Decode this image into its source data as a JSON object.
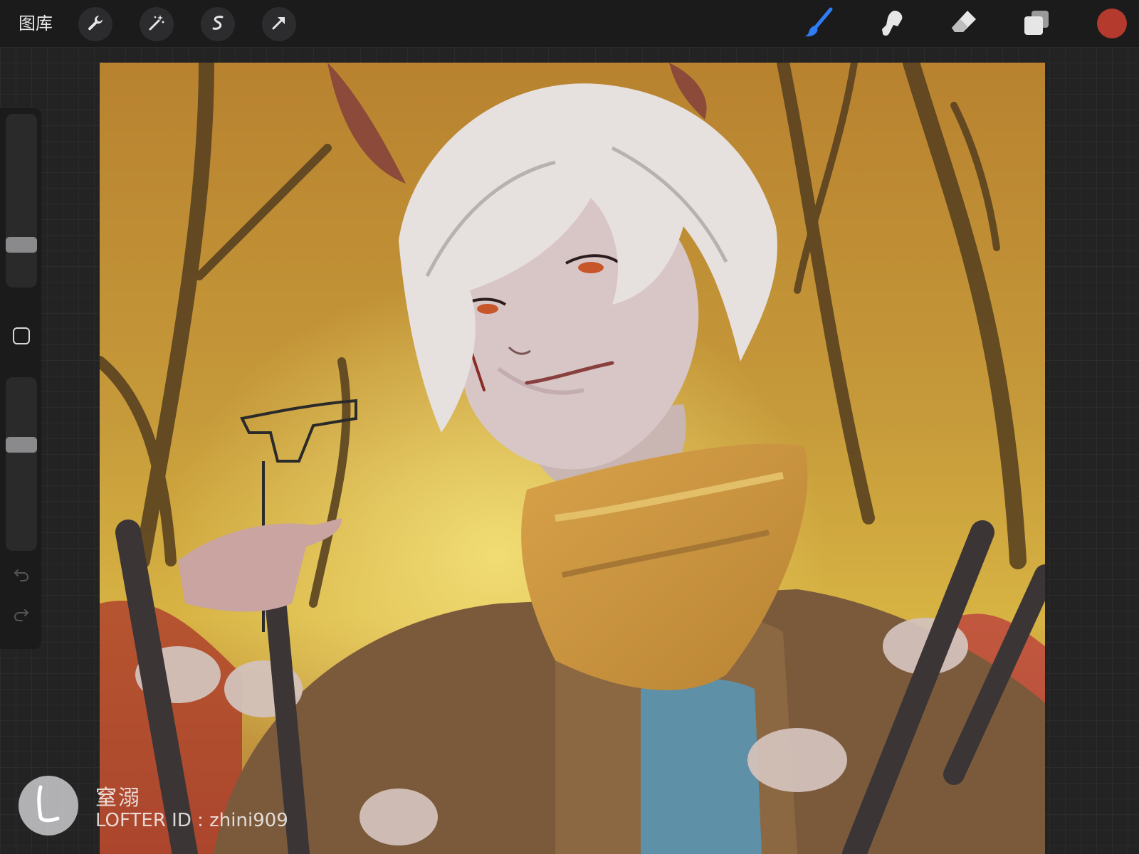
{
  "toolbar": {
    "gallery_label": "图库",
    "actions_icon": "wrench-icon",
    "adjustments_icon": "magic-wand-icon",
    "selection_icon": "selection-s-icon",
    "transform_icon": "arrow-cursor-icon",
    "brush_icon": "brush-icon",
    "smudge_icon": "smudge-finger-icon",
    "eraser_icon": "eraser-icon",
    "layers_icon": "layers-icon",
    "current_color": "#b43a2d",
    "active_tool_color": "#2f7df6"
  },
  "sidebar": {
    "brush_size": 0.22,
    "brush_opacity": 0.62,
    "modify_icon": "square-outline-icon",
    "undo_icon": "undo-icon",
    "redo_icon": "redo-icon"
  },
  "watermark": {
    "logo_icon": "lofter-l-icon",
    "name": "窒溺",
    "id_text": "LOFTER ID : zhini909"
  }
}
